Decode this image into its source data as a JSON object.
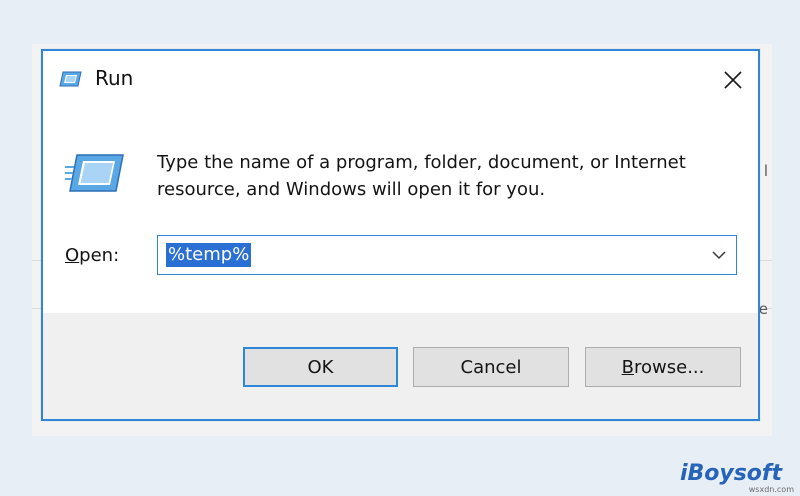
{
  "window": {
    "title": "Run",
    "title_icon": "run-icon",
    "close_icon": "close-icon"
  },
  "content": {
    "icon": "run-icon",
    "message": "Type the name of a program, folder, document, or Internet resource, and Windows will open it for you.",
    "open_label_accel": "O",
    "open_label_rest": "pen:",
    "open_value": "%temp%",
    "dropdown_icon": "chevron-down-icon"
  },
  "buttons": {
    "ok_label": "OK",
    "cancel_label": "Cancel",
    "browse_accel": "B",
    "browse_rest": "rowse..."
  },
  "backdrop": {
    "side_glyph_1": "l",
    "side_glyph_2": "e"
  },
  "branding": {
    "logo": "iBoysoft",
    "watermark": "wsxdn.com"
  },
  "colors": {
    "accent": "#2e86d6",
    "selection": "#2a6fd4",
    "footer_bg": "#f0f0f0",
    "button_bg": "#e1e1e1",
    "page_bg": "#e8eef6",
    "brand": "#2564b8"
  }
}
